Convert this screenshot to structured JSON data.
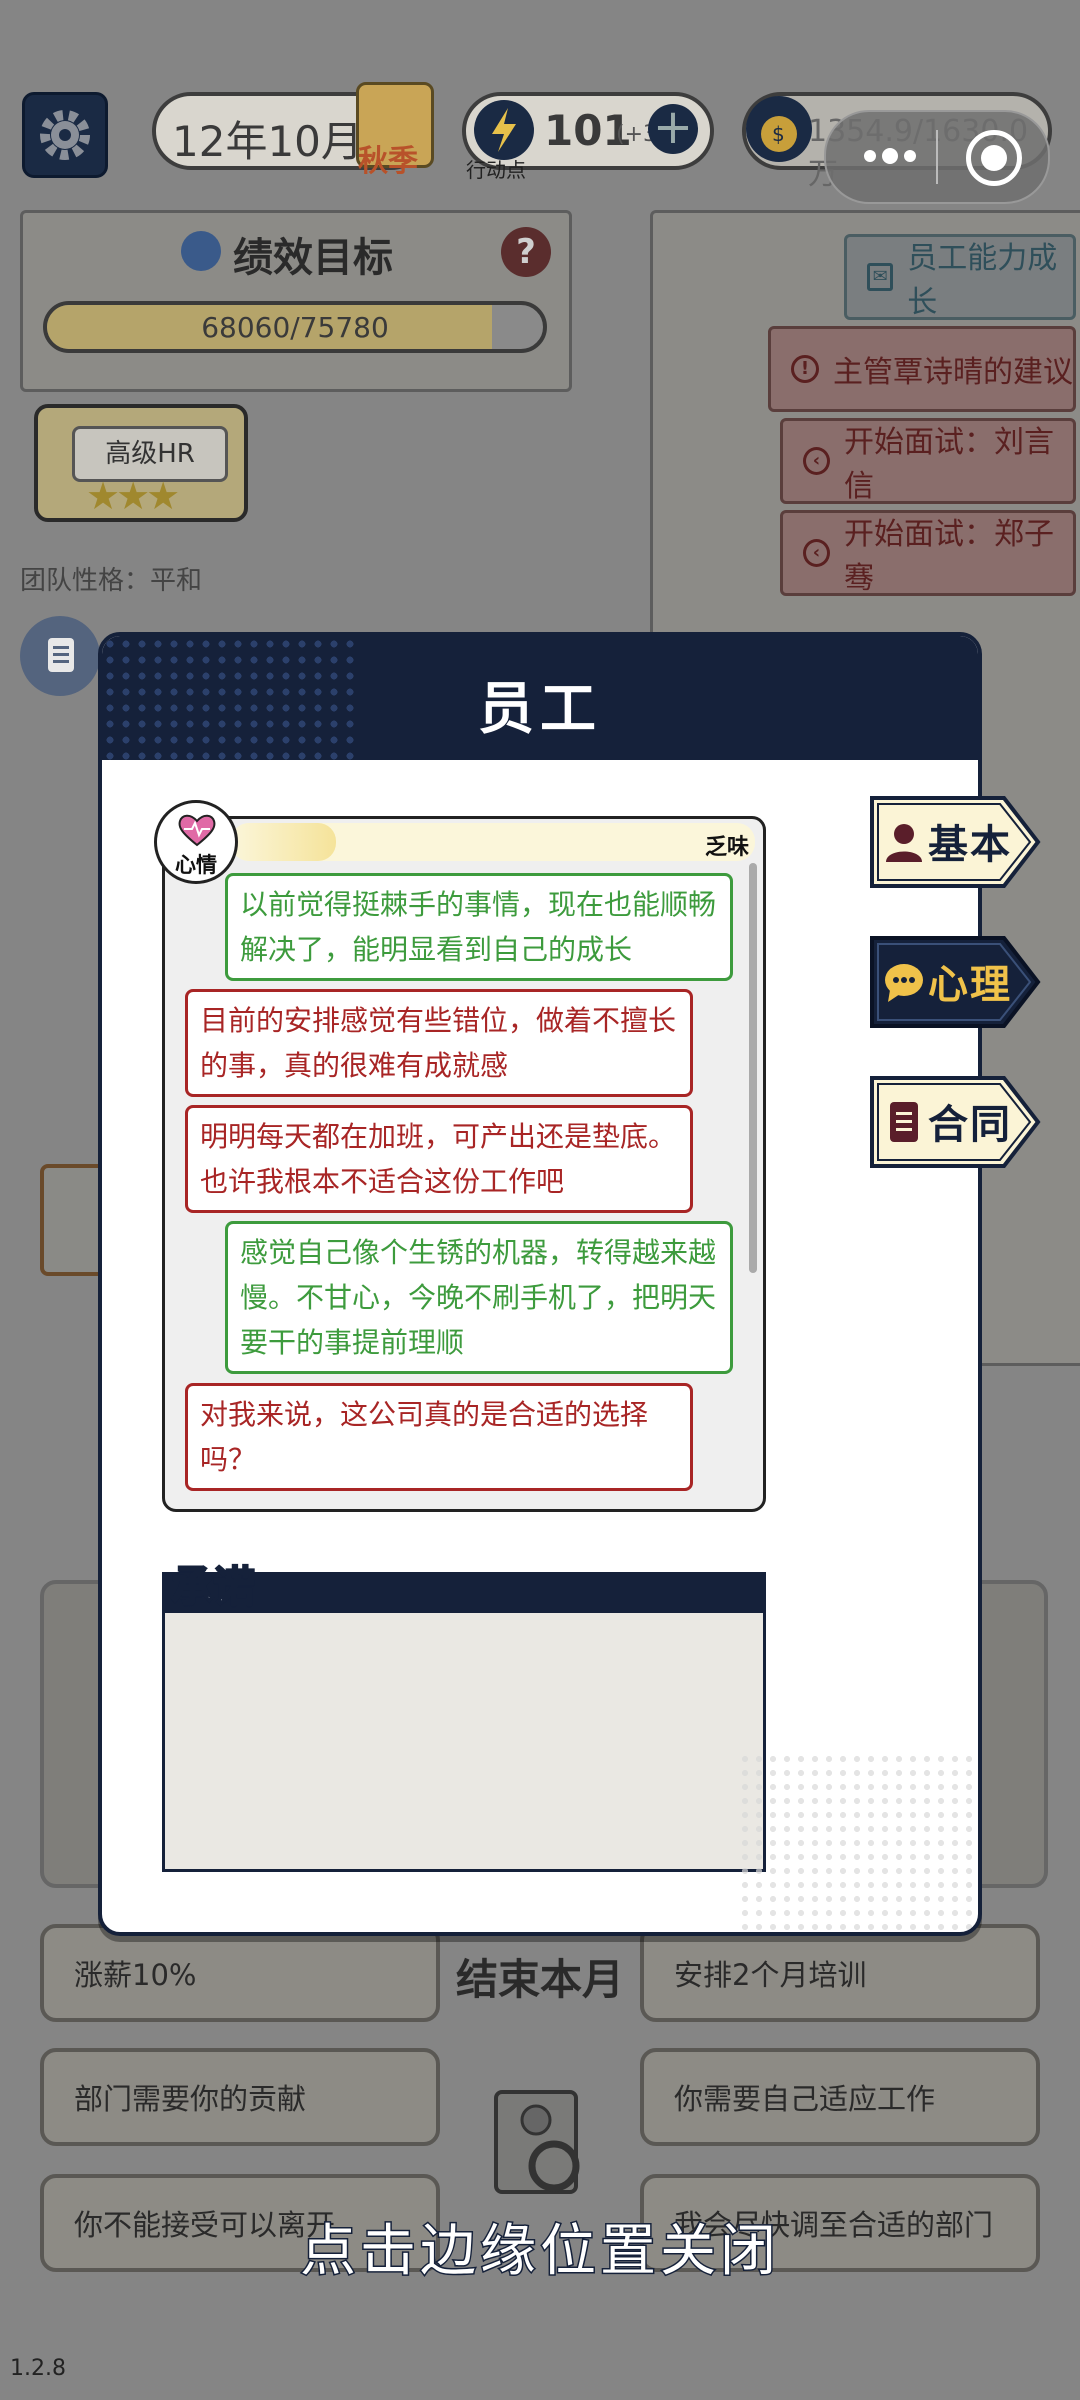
{
  "hud": {
    "date": "12年10月",
    "season": "秋季",
    "action_points": "101",
    "action_points_bonus": "(+3",
    "action_points_label": "行动点",
    "money": "1354.9/1630.0万"
  },
  "goal_panel": {
    "title": "绩效目标",
    "help": "?",
    "progress_text": "68060/75780",
    "progress": 0.898
  },
  "rank": {
    "title": "高级HR",
    "stars": 3
  },
  "team_trait": "团队性格：平和",
  "side_tasks": [
    {
      "label": "员工能力成长",
      "type": "mail"
    },
    {
      "label": "主管覃诗晴的建议",
      "type": "alert"
    },
    {
      "label": "开始面试：刘言信",
      "type": "arrow"
    },
    {
      "label": "开始面试：郑子骞",
      "type": "arrow"
    }
  ],
  "modal": {
    "title": "员工",
    "mood": {
      "label": "心情",
      "state": "乏味",
      "level": 0.2
    },
    "messages": [
      {
        "text": "以前觉得挺棘手的事情，现在也能顺畅解决了，能明显看到自己的成长",
        "tone": "positive"
      },
      {
        "text": "目前的安排感觉有些错位，做着不擅长的事，真的很难有成就感",
        "tone": "negative"
      },
      {
        "text": "明明每天都在加班，可产出还是垫底。也许我根本不适合这份工作吧",
        "tone": "negative"
      },
      {
        "text": "感觉自己像个生锈的机器，转得越来越慢。不甘心，今晚不刷手机了，把明天要干的事提前理顺",
        "tone": "positive"
      },
      {
        "text": "对我来说，这公司真的是合适的选择吗？",
        "tone": "negative"
      }
    ],
    "promise_title": "承诺",
    "tabs": [
      {
        "label": "基本",
        "active": false
      },
      {
        "label": "心理",
        "active": true
      },
      {
        "label": "合同",
        "active": false
      }
    ]
  },
  "options": {
    "left": [
      "涨薪10%",
      "部门需要你的贡献",
      "你不能接受可以离开"
    ],
    "right": [
      "安排2个月培训",
      "你需要自己适应工作",
      "我会尽快调至合适的部门"
    ],
    "end_month": "结束本月"
  },
  "close_hint": "点击边缘位置关闭",
  "version": "1.2.8",
  "colors": {
    "navy": "#15213a",
    "positive": "#3d9b3d",
    "negative": "#a82525",
    "overlay": "#858585"
  }
}
